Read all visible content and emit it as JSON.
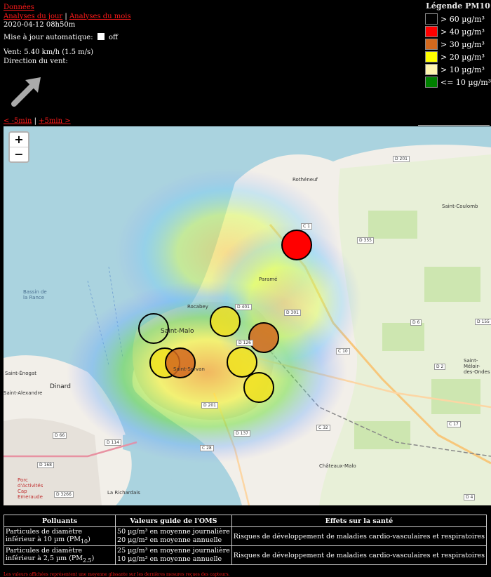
{
  "header": {
    "link_donnees": "Données",
    "link_jour": "Analyses du jour",
    "separator": "|",
    "link_mois": "Analyses du mois",
    "datetime": "2020-04-12 08h50m",
    "auto_update_label": "Mise à jour automatique:",
    "auto_update_state": "off",
    "wind_speed": "Vent: 5.40 km/h (1.5 m/s)",
    "wind_direction_label": "Direction du vent:",
    "wind_arrow_icon": "wind-direction-arrow-icon",
    "time_prev": "< -5min",
    "time_sep": "|",
    "time_next": "+5min >"
  },
  "legend": {
    "title": "Légende PM10",
    "items": [
      {
        "color": "#000000",
        "label": "> 60 µg/m³"
      },
      {
        "color": "#ff0000",
        "label": "> 40 µg/m³"
      },
      {
        "color": "#d2691e",
        "label": "> 30 µg/m³"
      },
      {
        "color": "#ffff00",
        "label": "> 20 µg/m³"
      },
      {
        "color": "#fff5b0",
        "label": "> 10 µg/m³"
      },
      {
        "color": "#008000",
        "label": "<= 10 µg/m³"
      }
    ]
  },
  "map": {
    "zoom_in": "+",
    "zoom_out": "−",
    "places": [
      "Rothéneuf",
      "Saint-Coulomb",
      "Saint-Malo",
      "Paramé",
      "Rocabey",
      "Saint-Énogat",
      "Dinard",
      "Saint-Alexandre",
      "Saint-Méloir-des-Ondes",
      "Châteaux-Malo",
      "La Richardais",
      "Porc d'Activités Cap Emeraude",
      "Bassin de la Rance",
      "Saint-Servan"
    ],
    "roads": [
      "D 201",
      "D 355",
      "C 1",
      "D 401",
      "D 301",
      "D 6",
      "D 155",
      "C 10",
      "D 2",
      "C 17",
      "D 201",
      "C 32",
      "D 137",
      "C 28",
      "D 66",
      "D 114",
      "D 168",
      "D 3266",
      "D 4",
      "D 126"
    ],
    "sensors": [
      {
        "name": "sensor-1",
        "level": "> 40 µg/m³",
        "color": "#ff0000"
      },
      {
        "name": "sensor-2",
        "level": "> 20 µg/m³",
        "color": "#f0e020"
      },
      {
        "name": "sensor-3",
        "level": "> 30 µg/m³",
        "color": "#d2691e"
      },
      {
        "name": "sensor-4",
        "level": "<= 10 µg/m³",
        "color": "transparent"
      },
      {
        "name": "sensor-5",
        "level": "> 20 µg/m³",
        "color": "#f0e020"
      },
      {
        "name": "sensor-6",
        "level": "> 30 µg/m³",
        "color": "#d2691e"
      },
      {
        "name": "sensor-7",
        "level": "> 20 µg/m³",
        "color": "#f0e020"
      },
      {
        "name": "sensor-8",
        "level": "> 20 µg/m³",
        "color": "#f0e020"
      }
    ]
  },
  "table": {
    "headers": [
      "Polluants",
      "Valeurs guide de l'OMS",
      "Effets sur la santé"
    ],
    "rows": [
      {
        "pollutant": "Particules de diamètre inférieur à 10 µm (PM",
        "pollutant_sub": "10",
        "pollutant_end": ")",
        "guide_1": "50 µg/m³ en moyenne journalière",
        "guide_2": "20 µg/m³ en moyenne annuelle",
        "effects": "Risques de développement de maladies cardio-vasculaires et respiratoires"
      },
      {
        "pollutant": "Particules de diamètre inférieur à 2,5 µm (PM",
        "pollutant_sub": "2.5",
        "pollutant_end": ")",
        "guide_1": "25 µg/m³ en moyenne journalière",
        "guide_2": "10 µg/m³ en moyenne annuelle",
        "effects": "Risques de développement de maladies cardio-vasculaires et respiratoires"
      }
    ]
  },
  "footer": {
    "note": "Les valeurs affichées représentent une moyenne glissante sur les dernières mesures reçues des capteurs."
  }
}
